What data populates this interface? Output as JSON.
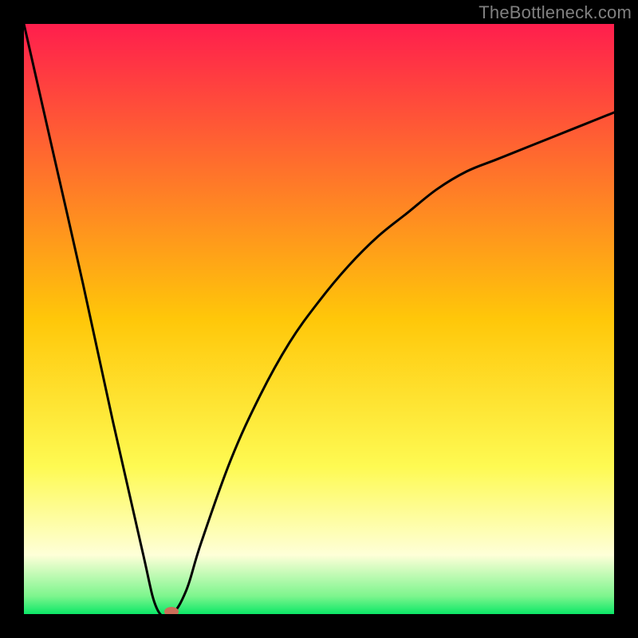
{
  "branding": {
    "watermark": "TheBottleneck.com"
  },
  "chart_data": {
    "type": "line",
    "title": "",
    "xlabel": "",
    "ylabel": "",
    "xlim": [
      0,
      100
    ],
    "ylim": [
      0,
      100
    ],
    "grid": false,
    "legend": false,
    "background": "heat-gradient",
    "series": [
      {
        "name": "bottleneck-curve",
        "x": [
          0,
          5,
          10,
          15,
          20,
          22.5,
          25,
          27.5,
          30,
          35,
          40,
          45,
          50,
          55,
          60,
          65,
          70,
          75,
          80,
          85,
          90,
          95,
          100
        ],
        "y": [
          100,
          78,
          56,
          33,
          11,
          1,
          0,
          4,
          12,
          26,
          37,
          46,
          53,
          59,
          64,
          68,
          72,
          75,
          77,
          79,
          81,
          83,
          85
        ]
      }
    ],
    "annotations": [
      {
        "name": "marker",
        "x": 25,
        "y": 0,
        "shape": "oval",
        "color": "#CC6E59"
      }
    ],
    "gradient_stops": [
      {
        "pos": 0,
        "color": "#FF1E4D"
      },
      {
        "pos": 50,
        "color": "#FFC709"
      },
      {
        "pos": 75,
        "color": "#FEFA52"
      },
      {
        "pos": 90,
        "color": "#FEFFD8"
      },
      {
        "pos": 97,
        "color": "#7CF58D"
      },
      {
        "pos": 100,
        "color": "#0CE767"
      }
    ]
  }
}
